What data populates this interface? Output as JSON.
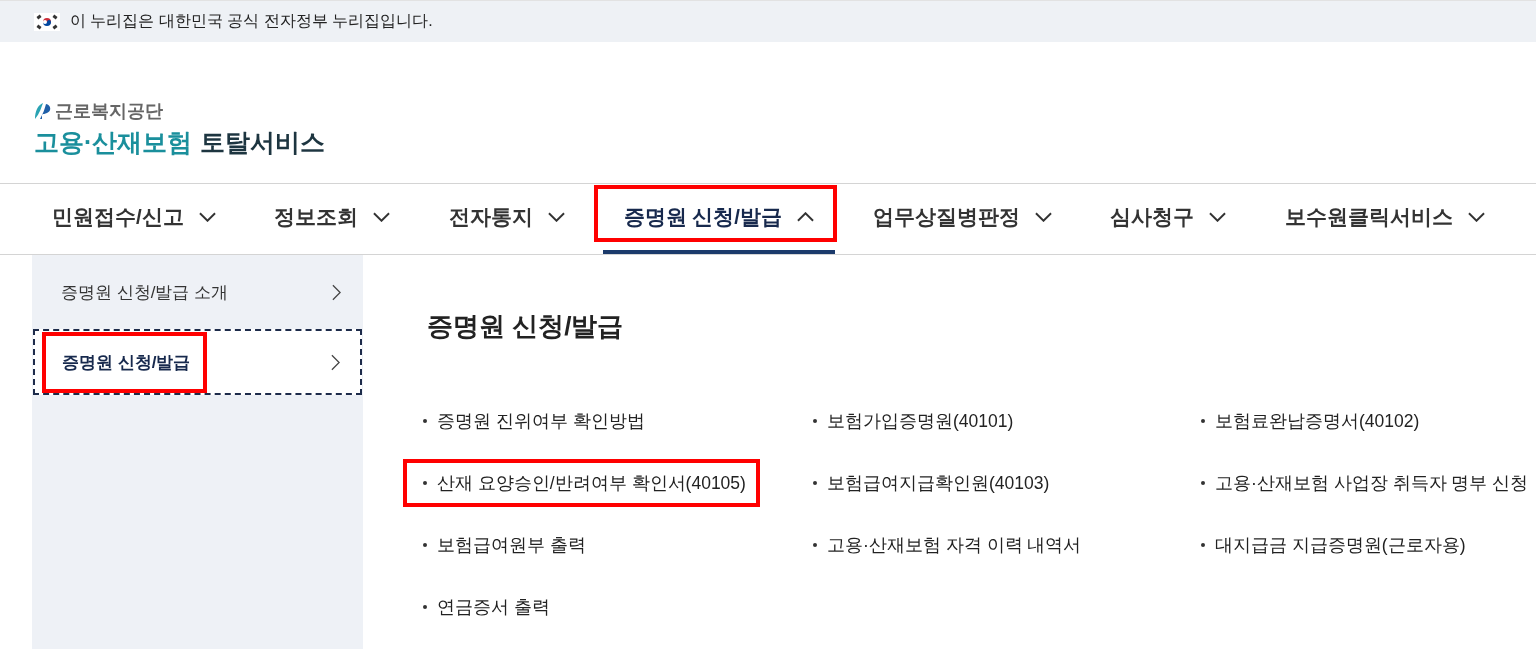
{
  "gov_banner": {
    "text": "이 누리집은 대한민국 공식 전자정부 누리집입니다."
  },
  "logo": {
    "org": "근로복지공단",
    "service_name": "고용·산재보험",
    "service_suffix": "토탈서비스"
  },
  "nav": [
    {
      "label": "민원접수/신고",
      "selected": false,
      "expanded": false,
      "highlighted": false
    },
    {
      "label": "정보조회",
      "selected": false,
      "expanded": false,
      "highlighted": false
    },
    {
      "label": "전자통지",
      "selected": false,
      "expanded": false,
      "highlighted": false
    },
    {
      "label": "증명원 신청/발급",
      "selected": true,
      "expanded": true,
      "highlighted": true
    },
    {
      "label": "업무상질병판정",
      "selected": false,
      "expanded": false,
      "highlighted": false
    },
    {
      "label": "심사청구",
      "selected": false,
      "expanded": false,
      "highlighted": false
    },
    {
      "label": "보수원클릭서비스",
      "selected": false,
      "expanded": false,
      "highlighted": false
    }
  ],
  "sidebar": {
    "items": [
      {
        "label": "증명원 신청/발급 소개",
        "selected": false,
        "highlighted": false
      },
      {
        "label": "증명원 신청/발급",
        "selected": true,
        "highlighted": true
      }
    ]
  },
  "content": {
    "heading": "증명원 신청/발급",
    "links": [
      {
        "label": "증명원 진위여부 확인방법",
        "highlighted": false
      },
      {
        "label": "보험가입증명원(40101)",
        "highlighted": false
      },
      {
        "label": "보험료완납증명서(40102)",
        "highlighted": false
      },
      {
        "label": "산재 요양승인/반려여부 확인서(40105)",
        "highlighted": true
      },
      {
        "label": "보험급여지급확인원(40103)",
        "highlighted": false
      },
      {
        "label": "고용·산재보험 사업장 취득자 명부 신청",
        "highlighted": false
      },
      {
        "label": "보험급여원부 출력",
        "highlighted": false
      },
      {
        "label": "고용·산재보험 자격 이력 내역서",
        "highlighted": false
      },
      {
        "label": "대지급금 지급증명원(근로자용)",
        "highlighted": false
      },
      {
        "label": "연금증서 출력",
        "highlighted": false
      }
    ]
  }
}
